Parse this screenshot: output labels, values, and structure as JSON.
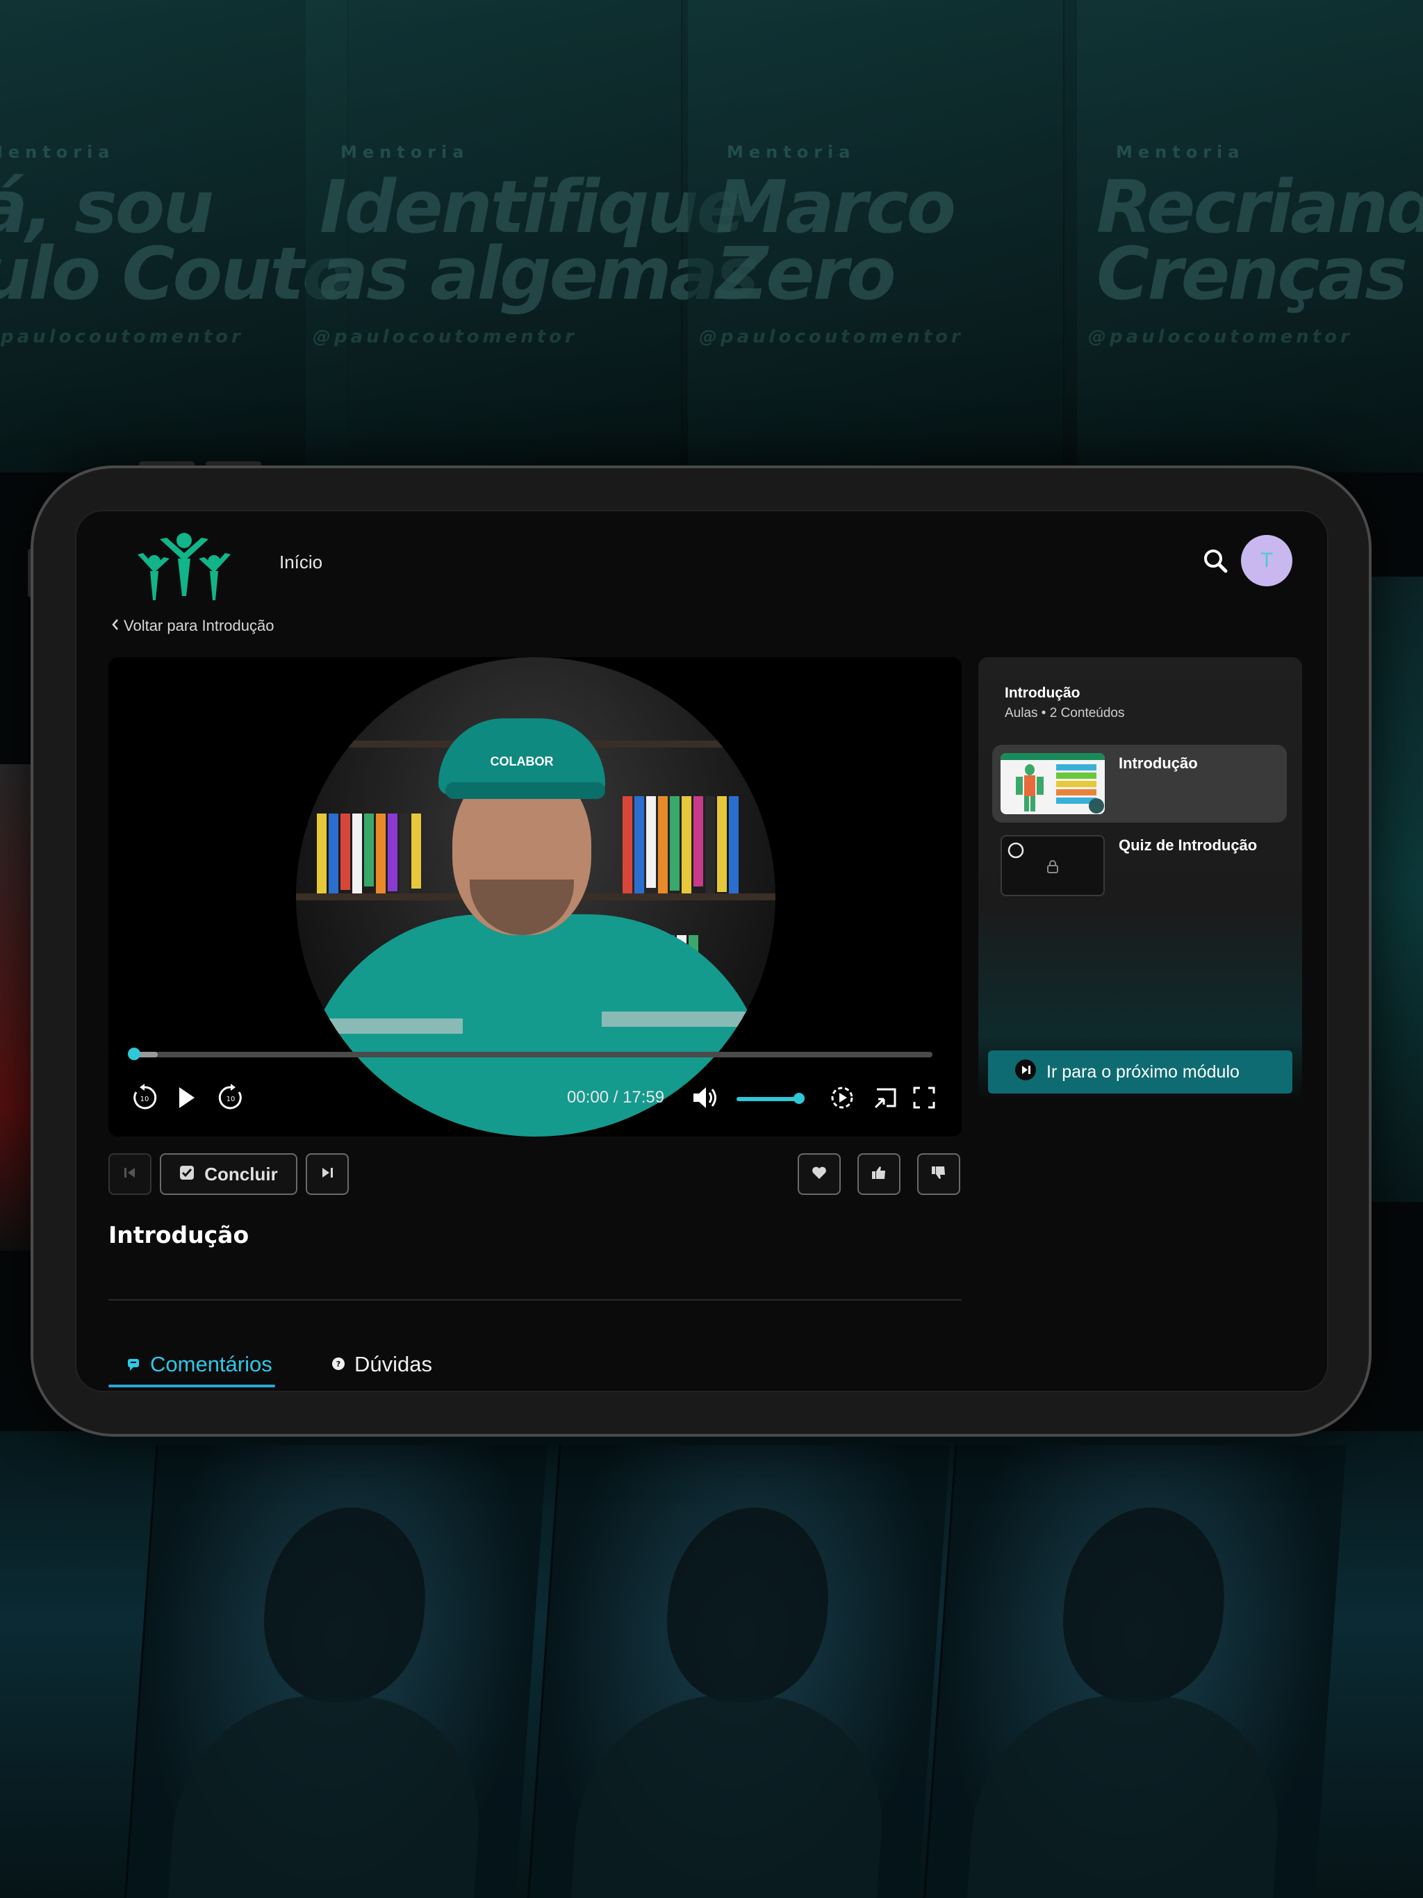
{
  "background": {
    "posters": [
      {
        "kicker": "Mentoria",
        "headline": "á, sou\nulo Couto",
        "handle": "@paulocoutomentor"
      },
      {
        "kicker": "Mentoria",
        "headline": "Identifique\nas algemas",
        "handle": "@paulocoutomentor"
      },
      {
        "kicker": "Mentoria",
        "headline": "Marco\nZero",
        "handle": "@paulocoutomentor"
      },
      {
        "kicker": "Mentoria",
        "headline": "Recriando\nCrenças",
        "handle": "@paulocoutomentor"
      }
    ]
  },
  "header": {
    "logo_icon": "people-logo-icon",
    "nav_home": "Início",
    "search_icon": "search-icon",
    "avatar_initial": "T"
  },
  "back_link": {
    "label": "Voltar para Introdução"
  },
  "video": {
    "cap_logo_text": "COLABOR",
    "progress_fraction": 0.0,
    "buffered_fraction": 0.03,
    "time_display": "00:00 / 17:59",
    "volume_fraction": 1.0,
    "controls": [
      "rewind-10-icon",
      "play-icon",
      "forward-10-icon",
      "volume-icon",
      "speed-icon",
      "cast-icon",
      "fullscreen-icon"
    ]
  },
  "playlist": {
    "title": "Introdução",
    "subtitle": "Aulas • 2 Conteúdos",
    "items": [
      {
        "label": "Introdução",
        "active": true,
        "locked": false
      },
      {
        "label": "Quiz de Introdução",
        "active": false,
        "locked": true
      }
    ],
    "next_module_label": "Ir para o próximo módulo"
  },
  "actions": {
    "concluir_label": "Concluir"
  },
  "lesson": {
    "title": "Introdução"
  },
  "tabs": [
    {
      "label": "Comentários",
      "active": true
    },
    {
      "label": "Dúvidas",
      "active": false
    }
  ],
  "colors": {
    "accent": "#2ec8d8",
    "logo_green": "#12b489",
    "next_module_bg": "#0e6b72",
    "avatar_bg": "#c9b8f0",
    "tab_active": "#2aa6d8"
  }
}
